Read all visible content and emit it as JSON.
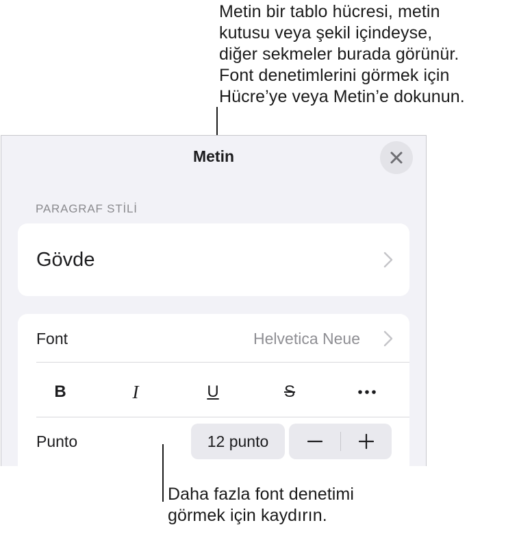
{
  "annotations": {
    "top_lines": [
      "Metin bir tablo hücresi, metin",
      "kutusu veya şekil içindeyse,",
      "diğer sekmeler burada görünür.",
      "Font denetimlerini görmek için",
      "Hücre’ye veya Metin’e dokunun."
    ],
    "bottom_lines": [
      "Daha fazla font denetimi",
      "görmek için kaydırın."
    ]
  },
  "panel": {
    "title": "Metin",
    "close_icon": "xmark-icon",
    "paragraph_style": {
      "header": "PARAGRAF STİLİ",
      "value": "Gövde"
    },
    "font_row": {
      "label": "Font",
      "value": "Helvetica Neue"
    },
    "format_buttons": {
      "bold": "B",
      "italic": "I",
      "underline": "U",
      "strikethrough": "S",
      "more_icon": "ellipsis-icon"
    },
    "size_row": {
      "label": "Punto",
      "value": "12 punto",
      "decrease_icon": "minus-icon",
      "increase_icon": "plus-icon"
    }
  },
  "colors": {
    "panel_background": "#f2f2f7",
    "card_background": "#ffffff",
    "secondary_text": "#8e8e93",
    "control_background": "#e9e9ee"
  }
}
